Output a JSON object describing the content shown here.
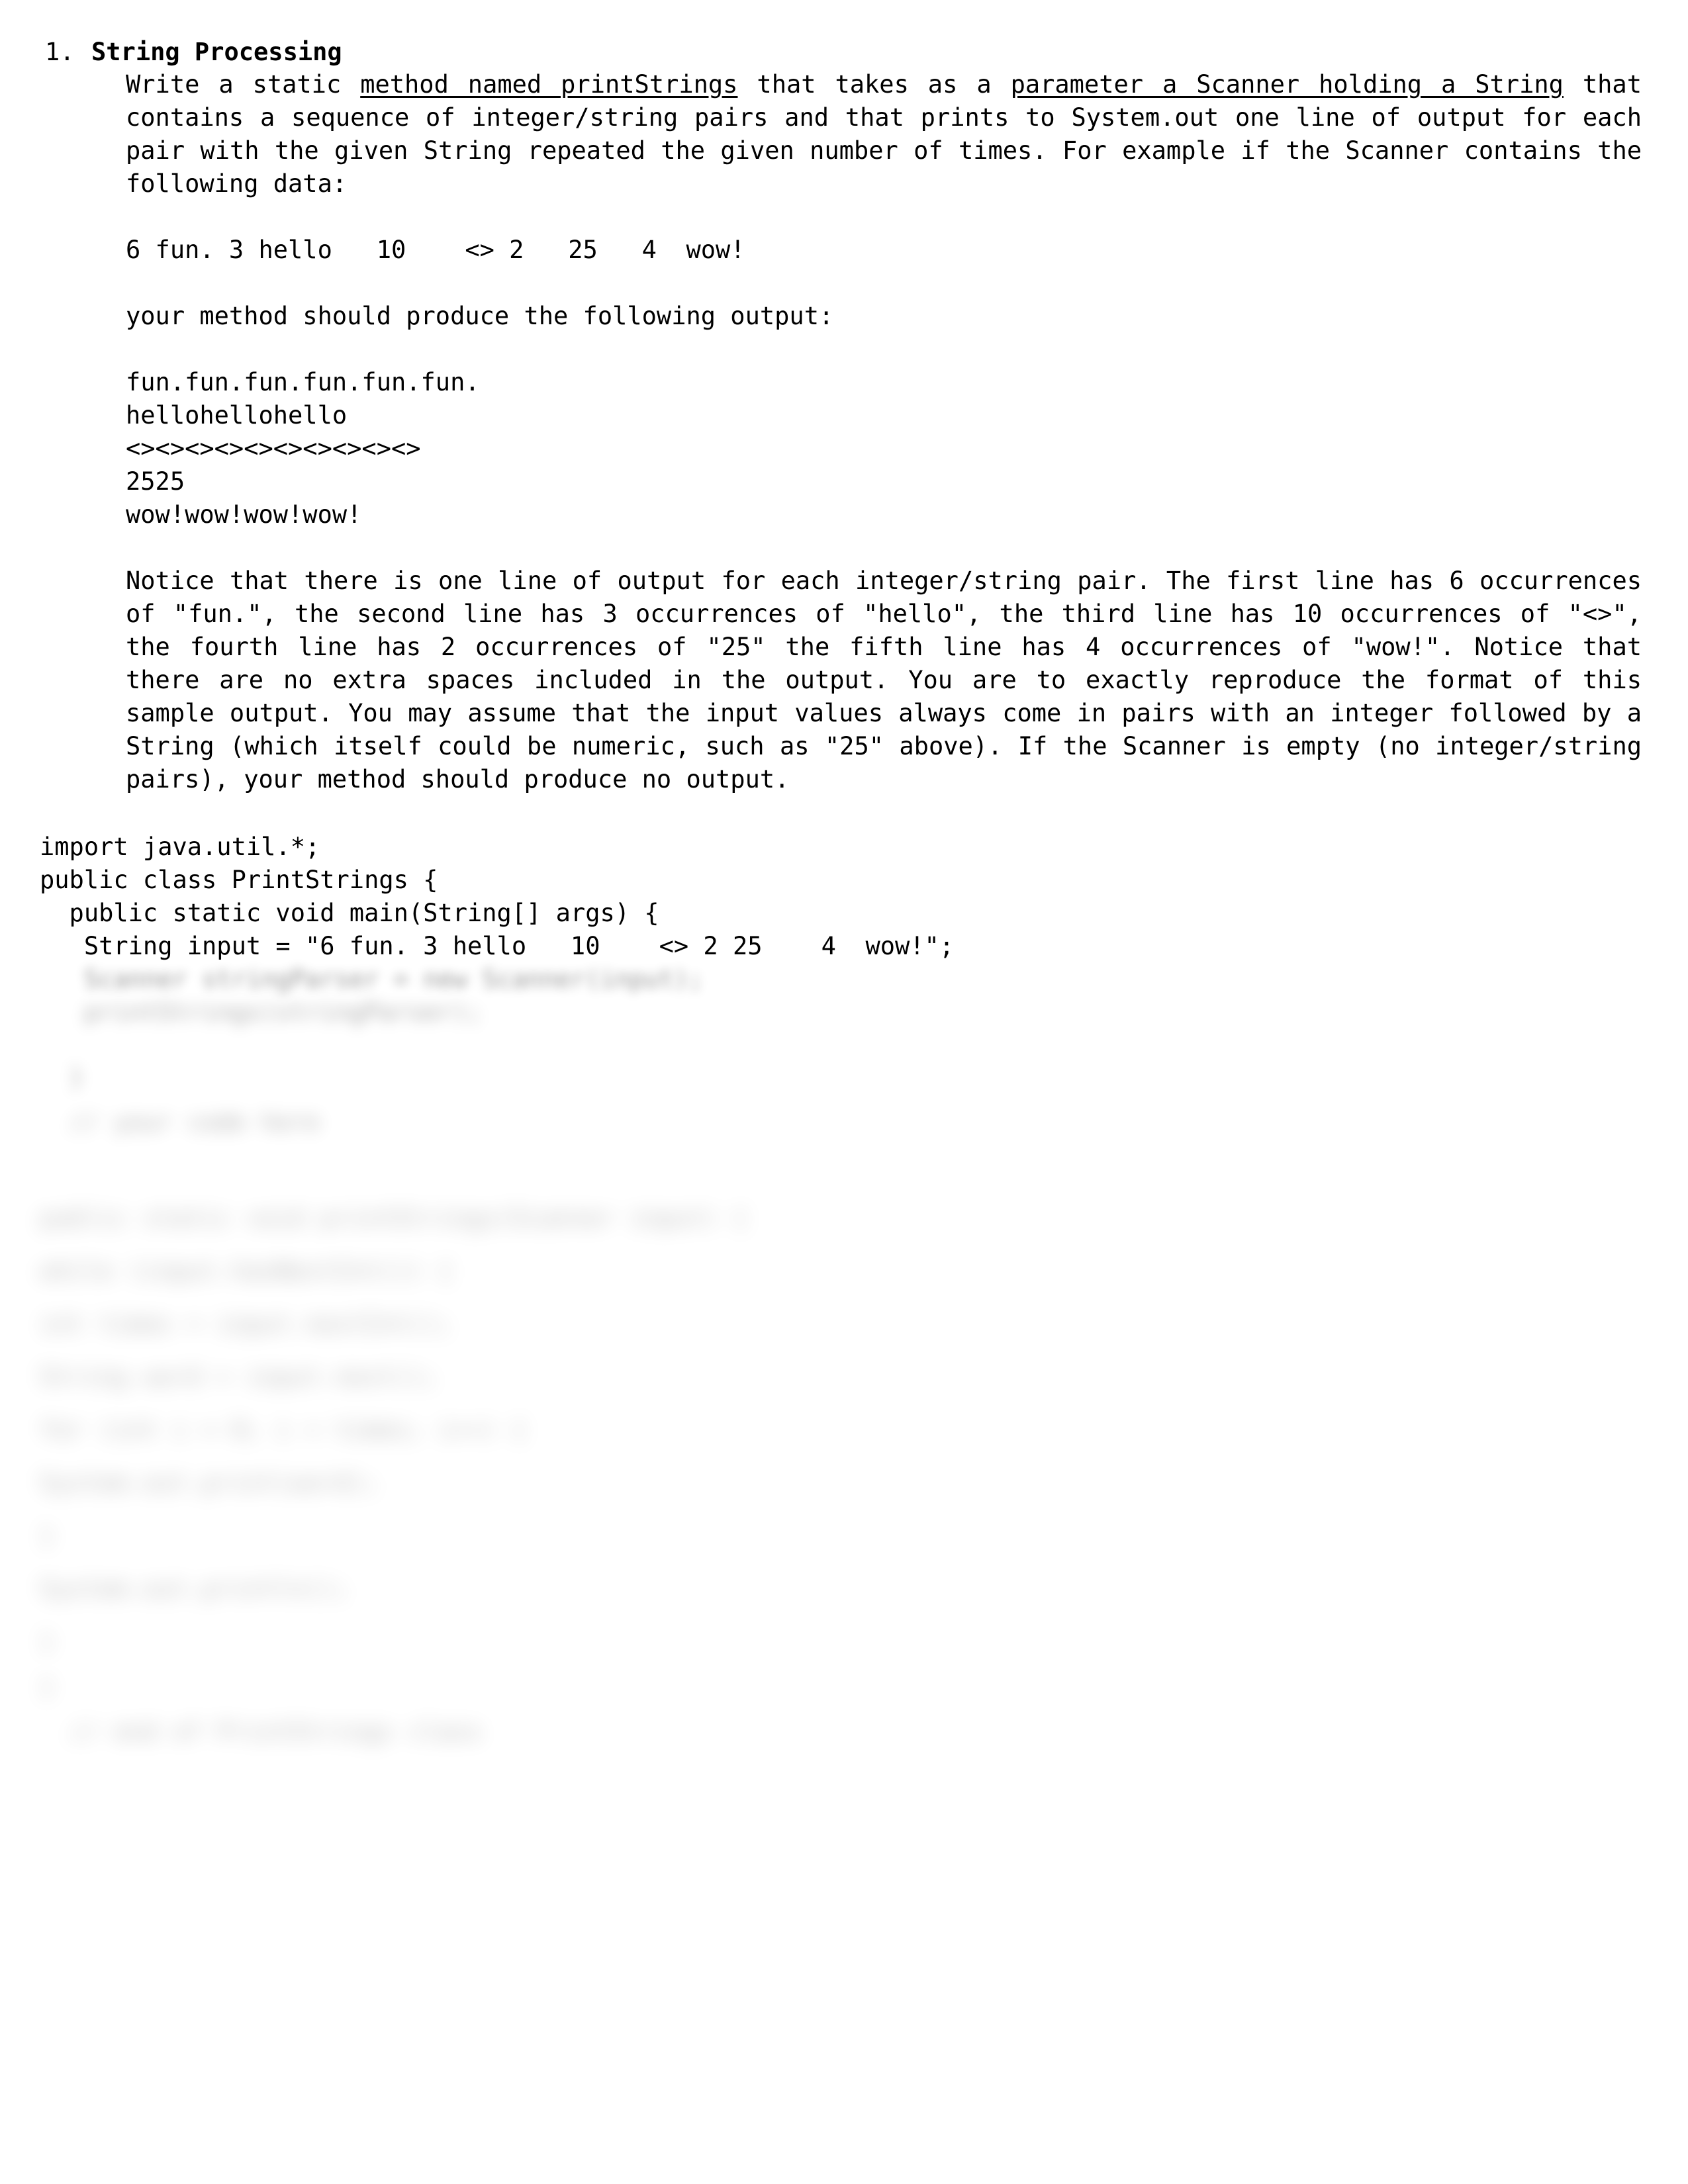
{
  "document": {
    "problem_number": "1.",
    "problem_title": "String Processing",
    "intro_paragraph": {
      "segment_1": "Write a static ",
      "underlined_1": "method named printStrings",
      "segment_2": " that takes as a ",
      "underlined_2": "parameter a Scanner holding a String",
      "segment_3": " that contains a sequence of integer/string pairs and that prints to System.out one line of output for each pair with the given String repeated the given number of times.  For example if the Scanner contains the following data:"
    },
    "sample_input": "6 fun. 3 hello   10    <> 2   25   4  wow!",
    "output_lead_in": "your method should produce the following output:",
    "sample_output": [
      "fun.fun.fun.fun.fun.fun.",
      "hellohellohello",
      "<><><><><><><><><><>",
      "2525",
      "wow!wow!wow!wow!"
    ],
    "notice_paragraph": "Notice that there is one line of output for each integer/string pair.  The first line has 6 occurrences of \"fun.\", the second line has 3 occurrences of \"hello\", the third line has 10 occurrences of \"<>\", the fourth line has 2 occurrences of \"25\" the fifth line has 4 occurrences of \"wow!\".  Notice that there are no extra spaces included in the output.  You are to exactly reproduce the format of this sample output.  You may assume that the input values always come in pairs with an integer followed by a String (which itself could be numeric, such as \"25\" above).  If the Scanner is empty (no integer/string pairs), your method should produce no output."
  },
  "code": {
    "visible_lines": [
      "import java.util.*;",
      "public class PrintStrings {",
      "",
      "  public static void main(String[] args) {",
      "   String input = \"6 fun. 3 hello   10    <> 2 25    4  wow!\";"
    ],
    "redacted_lines": [
      {
        "text": "   Scanner stringParser = new Scanner(input);",
        "blur": "b2",
        "indent": ""
      },
      {
        "text": "   printStrings(stringParser);",
        "blur": "b3",
        "indent": ""
      },
      {
        "text": "",
        "blur": "b3",
        "indent": ""
      },
      {
        "text": "  }",
        "blur": "b3",
        "indent": ""
      },
      {
        "text": "",
        "blur": "b4",
        "indent": ""
      },
      {
        "text": "  // your code here",
        "blur": "b4",
        "indent": ""
      },
      {
        "text": "",
        "blur": "b4",
        "indent": ""
      },
      {
        "text": "public static void printStrings(Scanner input) {",
        "blur": "b5",
        "indent": ""
      },
      {
        "text": "while (input.hasNextInt()) {",
        "blur": "b5",
        "indent": ""
      },
      {
        "text": "int times = input.nextInt();",
        "blur": "b5",
        "indent": ""
      },
      {
        "text": "String word = input.next();",
        "blur": "b5",
        "indent": ""
      },
      {
        "text": "for (int i = 0; i < times; i++) {",
        "blur": "b5",
        "indent": ""
      },
      {
        "text": "System.out.print(word);",
        "blur": "b5",
        "indent": ""
      },
      {
        "text": "}",
        "blur": "b5",
        "indent": ""
      },
      {
        "text": "System.out.println();",
        "blur": "b5",
        "indent": ""
      },
      {
        "text": "}",
        "blur": "b5",
        "indent": ""
      },
      {
        "text": "}",
        "blur": "b5",
        "indent": ""
      },
      {
        "text": "  // end of PrintStrings class",
        "blur": "b5",
        "indent": ""
      }
    ]
  },
  "page": {
    "background_color": "#ffffff",
    "text_color": "#000000"
  }
}
